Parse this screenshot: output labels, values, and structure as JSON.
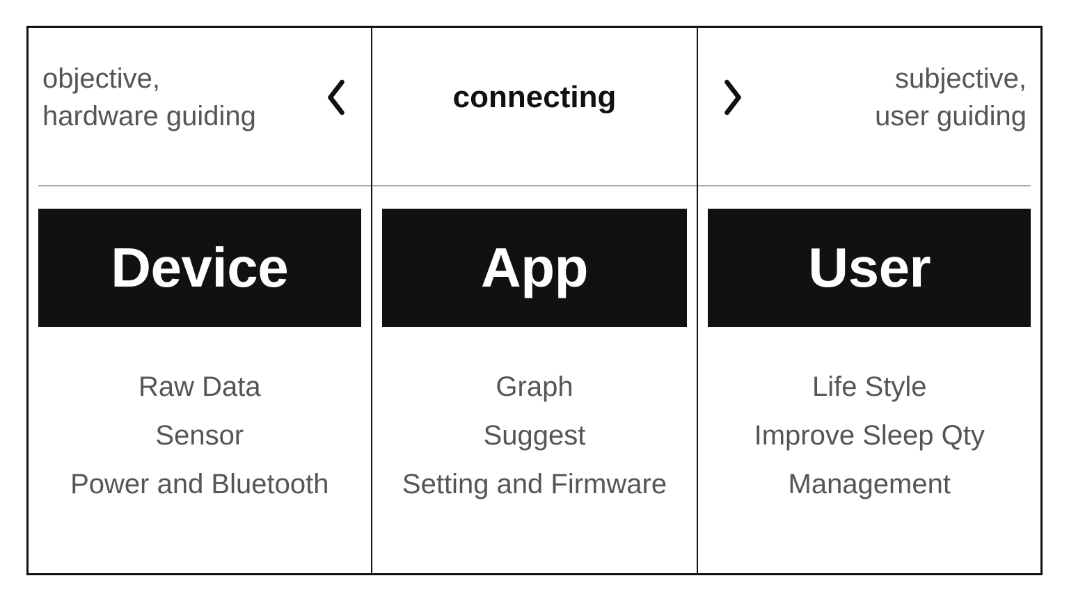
{
  "left": {
    "header_line1": "objective,",
    "header_line2": "hardware guiding",
    "title": "Device",
    "items": [
      "Raw Data",
      "Sensor",
      "Power and Bluetooth"
    ]
  },
  "center": {
    "header": "connecting",
    "title": "App",
    "items": [
      "Graph",
      "Suggest",
      "Setting and Firmware"
    ]
  },
  "right": {
    "header_line1": "subjective,",
    "header_line2": "user guiding",
    "title": "User",
    "items": [
      "Life Style",
      "Improve Sleep Qty",
      "Management"
    ]
  }
}
